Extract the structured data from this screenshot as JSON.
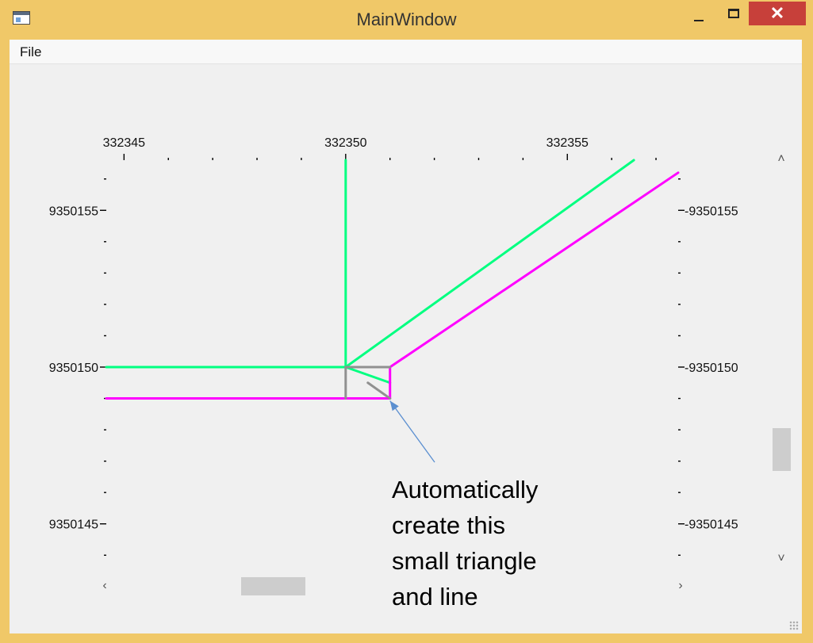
{
  "window": {
    "title": "MainWindow",
    "icon": "app-window-icon",
    "controls": {
      "minimize": "minimize-icon",
      "maximize": "maximize-icon",
      "close": "close-icon",
      "close_glyph": "✕"
    },
    "frame_color": "#f0c868",
    "close_color": "#c7403a"
  },
  "menubar": {
    "items": [
      {
        "label": "File"
      }
    ]
  },
  "chart_data": {
    "type": "line",
    "x_ticks": [
      "332345",
      "332350",
      "332355"
    ],
    "y_ticks": [
      "9350155",
      "9350150",
      "9350145"
    ],
    "xlim": [
      332344.6,
      332357.5
    ],
    "ylim": [
      9350143.4,
      9350156.6
    ],
    "series": [
      {
        "color": "#00ff80",
        "segments": [
          [
            [
              332350,
              9350156.6
            ],
            [
              332350,
              9350150
            ]
          ],
          [
            [
              332344.6,
              9350150
            ],
            [
              332350,
              9350150
            ]
          ],
          [
            [
              332350,
              9350150
            ],
            [
              332356.5,
              9350156.6
            ]
          ],
          [
            [
              332350,
              9350150
            ],
            [
              332351,
              9350149.5
            ]
          ]
        ]
      },
      {
        "color": "#ff00ff",
        "segments": [
          [
            [
              332344.6,
              9350149
            ],
            [
              332351,
              9350149
            ]
          ],
          [
            [
              332351,
              9350149
            ],
            [
              332351,
              9350150
            ]
          ],
          [
            [
              332351,
              9350150
            ],
            [
              332357.5,
              9350156.2
            ]
          ]
        ]
      },
      {
        "color": "#909090",
        "segments": [
          [
            [
              332350,
              9350150
            ],
            [
              332351,
              9350150
            ]
          ],
          [
            [
              332350,
              9350150
            ],
            [
              332350,
              9350149
            ]
          ],
          [
            [
              332350.5,
              9350149.5
            ],
            [
              332351,
              9350149
            ]
          ]
        ]
      }
    ]
  },
  "annotation": {
    "text": "Automatically\ncreate this\nsmall triangle\nand line",
    "arrow_color": "#5b8fd0"
  },
  "scrollbars": {
    "vertical": {
      "up": "chevron-up-icon",
      "down": "chevron-down-icon",
      "up_glyph": "˄",
      "down_glyph": "˅"
    },
    "horizontal": {
      "left": "chevron-left-icon",
      "right": "chevron-right-icon",
      "left_glyph": "‹",
      "right_glyph": "›"
    }
  }
}
